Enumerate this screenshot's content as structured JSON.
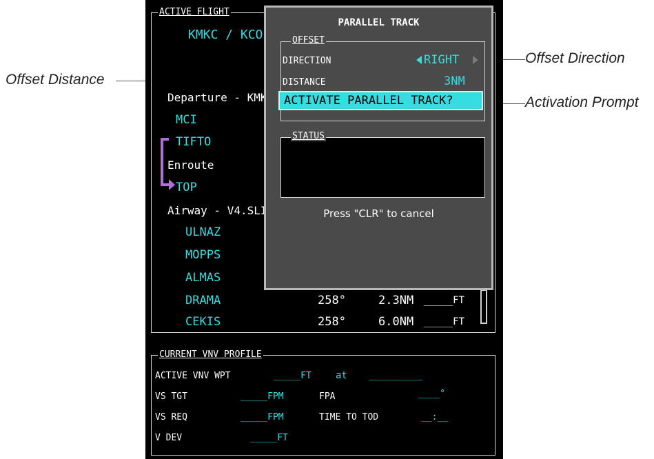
{
  "flightplan": {
    "title": "ACTIVE FLIGHT",
    "route": "KMKC / KCO",
    "departure": "Departure - KMK",
    "legs_top": [
      "MCI",
      "TIFTO"
    ],
    "enroute": "Enroute",
    "top_leg": "TOP",
    "airway": "Airway - V4.SLI",
    "airway_legs": [
      "ULNAZ",
      "MOPPS",
      "ALMAS"
    ],
    "rows": [
      {
        "wpt": "DRAMA",
        "dtk": "258°",
        "dis": "2.3NM",
        "alt": "_____FT"
      },
      {
        "wpt": "CEKIS",
        "dtk": "258°",
        "dis": "6.0NM",
        "alt": "_____FT"
      }
    ]
  },
  "parallel_track": {
    "title": "PARALLEL TRACK",
    "offset_label": "OFFSET",
    "direction_label": "DIRECTION",
    "direction_value": "RIGHT",
    "distance_label": "DISTANCE",
    "distance_value": "3NM",
    "activate_prompt": "ACTIVATE PARALLEL TRACK?",
    "status_label": "STATUS",
    "cancel_hint": "Press \"CLR\" to cancel"
  },
  "vnv": {
    "title": "CURRENT VNV PROFILE",
    "active_vnv_wpt_label": "ACTIVE VNV WPT",
    "active_vnv_wpt_value": "_____FT",
    "at_label": "at",
    "at_value": "__________",
    "vs_tgt_label": "VS TGT",
    "vs_tgt_value": "_____FPM",
    "fpa_label": "FPA",
    "fpa_value": "____°",
    "vs_req_label": "VS REQ",
    "vs_req_value": "_____FPM",
    "time_to_tod_label": "TIME TO TOD",
    "time_to_tod_value": "__:__",
    "v_dev_label": "V DEV",
    "v_dev_value": "_____FT"
  },
  "callouts": {
    "offset_distance": "Offset Distance",
    "offset_direction": "Offset Direction",
    "activation_prompt": "Activation Prompt"
  },
  "colors": {
    "cyan": "#33dde0",
    "magenta": "#b070d8",
    "highlight": "#33dde0"
  }
}
